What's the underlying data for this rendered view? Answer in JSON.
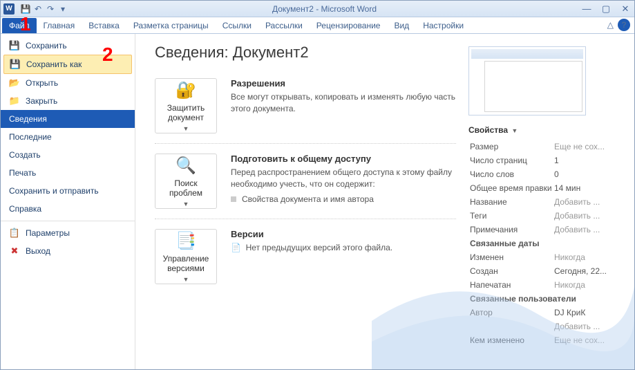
{
  "title": "Документ2 - Microsoft Word",
  "annotations": {
    "one": "1",
    "two": "2"
  },
  "tabs": {
    "file": "Файл",
    "home": "Главная",
    "insert": "Вставка",
    "layout": "Разметка страницы",
    "refs": "Ссылки",
    "mail": "Рассылки",
    "review": "Рецензирование",
    "view": "Вид",
    "settings": "Настройки"
  },
  "sidebar": {
    "save": "Сохранить",
    "saveas": "Сохранить как",
    "open": "Открыть",
    "close": "Закрыть",
    "info": "Сведения",
    "recent": "Последние",
    "new": "Создать",
    "print": "Печать",
    "sharesend": "Сохранить и отправить",
    "help": "Справка",
    "options": "Параметры",
    "exit": "Выход"
  },
  "main": {
    "heading": "Сведения: Документ2",
    "protect": {
      "title": "Разрешения",
      "text": "Все могут открывать, копировать и изменять любую часть этого документа.",
      "btn": "Защитить документ"
    },
    "prepare": {
      "title": "Подготовить к общему доступу",
      "text": "Перед распространением общего доступа к этому файлу необходимо учесть, что он содержит:",
      "sub": "Свойства документа и имя автора",
      "btn": "Поиск проблем"
    },
    "versions": {
      "title": "Версии",
      "text": "Нет предыдущих версий этого файла.",
      "btn": "Управление версиями"
    }
  },
  "props": {
    "head": "Свойства",
    "size": {
      "k": "Размер",
      "v": "Еще не сох..."
    },
    "pages": {
      "k": "Число страниц",
      "v": "1"
    },
    "words": {
      "k": "Число слов",
      "v": "0"
    },
    "edit": {
      "k": "Общее время правки",
      "v": "14 мин"
    },
    "title": {
      "k": "Название",
      "v": "Добавить ..."
    },
    "tags": {
      "k": "Теги",
      "v": "Добавить ..."
    },
    "notes": {
      "k": "Примечания",
      "v": "Добавить ..."
    },
    "dates_h": "Связанные даты",
    "changed": {
      "k": "Изменен",
      "v": "Никогда"
    },
    "created": {
      "k": "Создан",
      "v": "Сегодня, 22..."
    },
    "printed": {
      "k": "Напечатан",
      "v": "Никогда"
    },
    "people_h": "Связанные пользователи",
    "author": {
      "k": "Автор",
      "v": "DJ КриК",
      "add": "Добавить ..."
    },
    "changedby": {
      "k": "Кем изменено",
      "v": "Еще не сох..."
    }
  }
}
